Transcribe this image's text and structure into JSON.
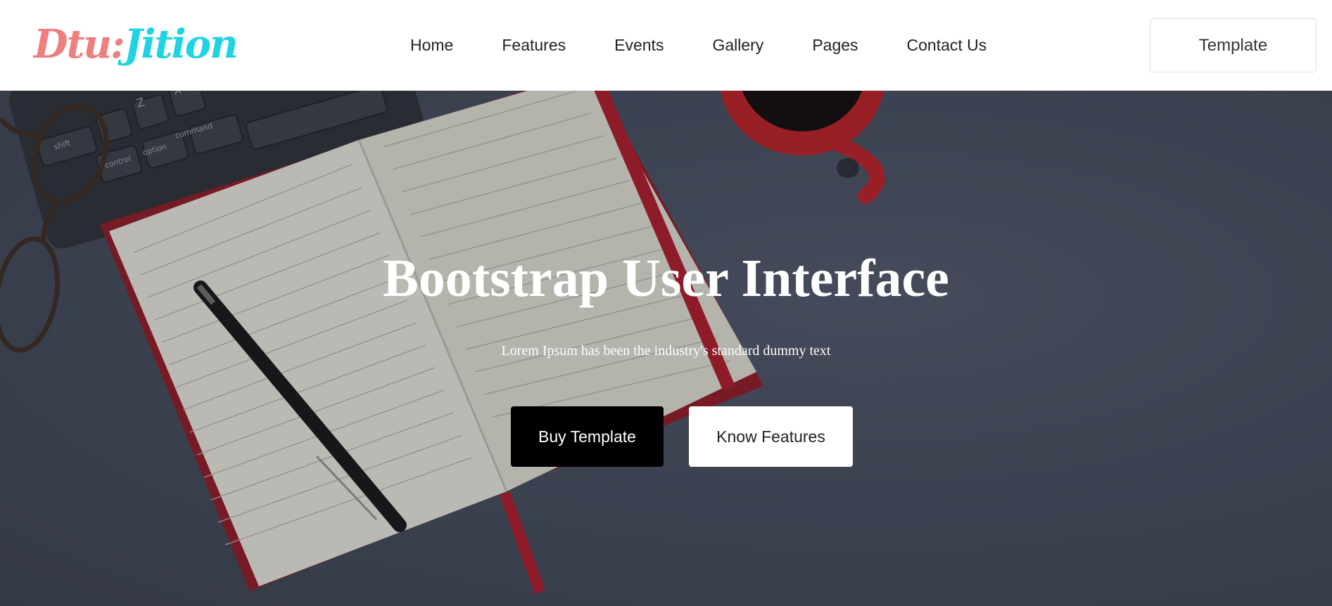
{
  "logo": {
    "part1": "Dtu:",
    "part2": "Jition"
  },
  "nav": {
    "items": [
      "Home",
      "Features",
      "Events",
      "Gallery",
      "Pages",
      "Contact Us"
    ]
  },
  "header": {
    "cta_label": "Template"
  },
  "hero": {
    "title": "Bootstrap User Interface",
    "subtitle": "Lorem Ipsum has been the industry's standard dummy text",
    "buy_label": "Buy Template",
    "features_label": "Know Features"
  },
  "photo": {
    "keyboard_keys": [
      "shift",
      "control",
      "option",
      "command",
      "Z",
      "X"
    ]
  },
  "colors": {
    "logo_pink": "#ee7f7f",
    "logo_cyan": "#1fd3e3",
    "hero_background": "#444a59",
    "buy_button": "#000000",
    "features_button": "#ffffff"
  }
}
